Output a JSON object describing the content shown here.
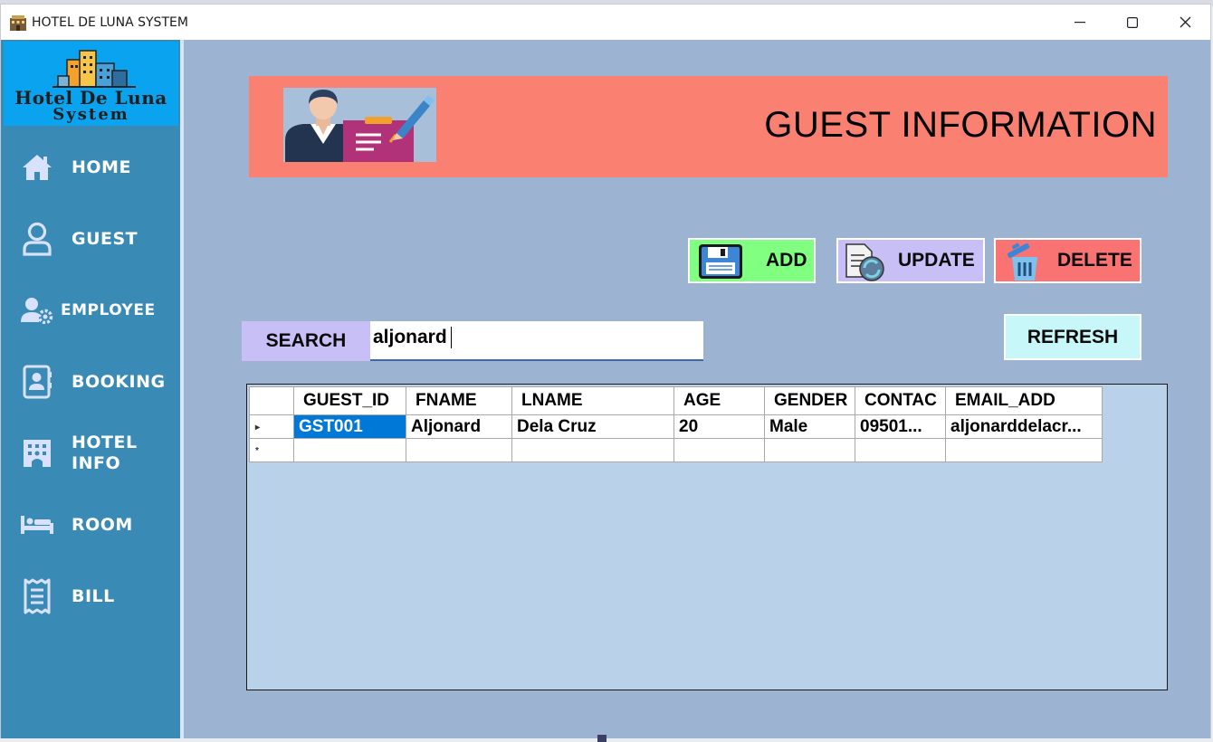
{
  "window": {
    "title": "HOTEL DE LUNA SYSTEM",
    "controls": [
      "minimize-icon",
      "maximize-icon",
      "close-icon"
    ]
  },
  "sidebar": {
    "logo": {
      "line1": "Hotel De Luna",
      "line2": "System"
    },
    "items": [
      {
        "label": "HOME",
        "icon": "home-icon"
      },
      {
        "label": "GUEST",
        "icon": "user-icon"
      },
      {
        "label": "EMPLOYEE",
        "icon": "user-gear-icon"
      },
      {
        "label": "BOOKING",
        "icon": "address-book-icon"
      },
      {
        "label": "HOTEL",
        "label2": "INFO",
        "icon": "hotel-icon"
      },
      {
        "label": "ROOM",
        "icon": "bed-icon"
      },
      {
        "label": "BILL",
        "icon": "receipt-icon"
      }
    ]
  },
  "banner": {
    "title": "GUEST INFORMATION",
    "image": "receptionist-clipboard-icon"
  },
  "actions": {
    "add": "ADD",
    "update": "UPDATE",
    "delete": "DELETE",
    "refresh": "REFRESH"
  },
  "search": {
    "label": "SEARCH",
    "value": "aljonard"
  },
  "grid": {
    "columns": [
      "GUEST_ID",
      "FNAME",
      "LNAME",
      "AGE",
      "GENDER",
      "CONTAC",
      "EMAIL_ADD"
    ],
    "rows": [
      [
        "GST001",
        "Aljonard",
        "Dela Cruz",
        "20",
        "Male",
        "09501...",
        "aljonarddelacr..."
      ]
    ],
    "new_row_marker": "*",
    "current_row_marker": "▸"
  },
  "colors": {
    "sidebar": "#3a8ab6",
    "logo_bg": "#0aa3ef",
    "main_bg": "#9cb4d1",
    "banner": "#fa8071",
    "add": "#80ff80",
    "update": "#c8bff6",
    "delete": "#fa7373",
    "refresh": "#c8f7fa",
    "selection": "#0078d7"
  }
}
